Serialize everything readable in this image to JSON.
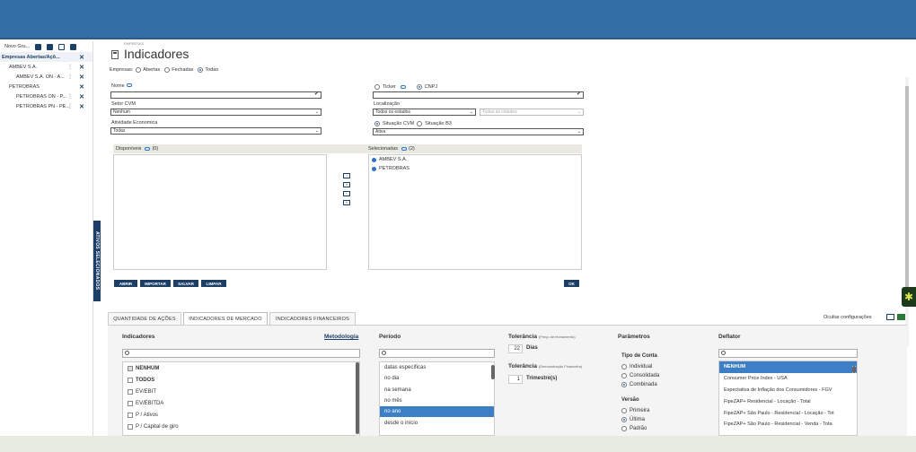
{
  "left_panel": {
    "toolbar_label": "Novo Gru...",
    "tree": [
      {
        "label": "Empresas Abertas/Açõ...",
        "header": true,
        "dots": false
      },
      {
        "label": "AMBEV S.A.",
        "indent": 1,
        "dots": true
      },
      {
        "label": "AMBEV S.A. ON - A...",
        "indent": 2,
        "dots": true
      },
      {
        "label": "PETROBRAS",
        "indent": 1,
        "dots": false
      },
      {
        "label": "PETROBRAS ON - P...",
        "indent": 2,
        "dots": true
      },
      {
        "label": "PETROBRAS PN - PE...",
        "indent": 2,
        "dots": true
      }
    ],
    "side_tab": "ATIVOS SELECIONADOS"
  },
  "header": {
    "breadcrumb": "EMPRESAS",
    "title": "Indicadores"
  },
  "empresas": {
    "label": "Empresas:",
    "options": [
      "Abertas",
      "Fechadas",
      "Todas"
    ],
    "selected": "Todas"
  },
  "filters": {
    "nome_label": "Nome",
    "ticker_label": "Ticker",
    "cnpj_label": "CNPJ",
    "setor_label": "Setor CVM",
    "setor_value": "Nenhum",
    "localizacao_label": "Localização",
    "localizacao_value": "Todos os estados",
    "cidades_value": "Todas as cidades",
    "atividade_label": "Atividade Economica",
    "atividade_value": "Todas",
    "situacao_cvm_label": "Situação CVM",
    "situacao_b3_label": "Situação B3",
    "situacao_value": "Ativa"
  },
  "lists": {
    "disponiveis_label": "Disponíveis",
    "disponiveis_count": "(0)",
    "selecionadas_label": "Selecionadas",
    "selecionadas_count": "(2)",
    "selecionadas_items": [
      "AMBEV S.A.",
      "PETROBRAS"
    ]
  },
  "buttons": {
    "abrir": "ABRIR",
    "importar": "IMPORTAR",
    "salvar": "SALVAR",
    "limpar": "LIMPAR",
    "ok": "OK"
  },
  "tabs": [
    "QUANTIDADE DE AÇÕES",
    "INDICADORES DE MERCADO",
    "INDICADORES FINANCEIROS"
  ],
  "active_tab": "INDICADORES DE MERCADO",
  "ocultar_label": "Ocultar configurações",
  "indicadores": {
    "title": "Indicadores",
    "metodologia": "Metodologia",
    "items": [
      {
        "label": "NENHUM",
        "bold": true,
        "checked": true
      },
      {
        "label": "TODOS",
        "bold": true,
        "checked": false
      },
      {
        "label": "EV/EBIT",
        "bold": false,
        "checked": false
      },
      {
        "label": "EV/EBITDA",
        "bold": false,
        "checked": false
      },
      {
        "label": "P / Ativos",
        "bold": false,
        "checked": false
      },
      {
        "label": "P / Capital de giro",
        "bold": false,
        "checked": false
      }
    ]
  },
  "periodo": {
    "title": "Período",
    "items": [
      "datas específicas",
      "no dia",
      "na semana",
      "no mês",
      "no ano",
      "desde o início"
    ],
    "selected": "no ano"
  },
  "tolerancia": {
    "title1": "Tolerância",
    "note1": "(Preço de fechamento)",
    "value1": "22",
    "unit1": "Dias",
    "title2": "Tolerância",
    "note2": "(Demonstração Financeira)",
    "value2": "1",
    "unit2": "Trimestre(s)"
  },
  "parametros": {
    "title": "Parâmetros",
    "tipo_label": "Tipo de Conta",
    "tipo_options": [
      "Individual",
      "Consolidada",
      "Combinada"
    ],
    "tipo_selected": "Combinada",
    "versao_label": "Versão",
    "versao_options": [
      "Primeira",
      "Última",
      "Padrão"
    ],
    "versao_selected": "Última"
  },
  "deflator": {
    "title": "Deflator",
    "items": [
      "NENHUM",
      "Consumer Price Index - USA",
      "Expectativa de Inflação dos Consumidores - FGV",
      "FipeZAP+ Residencial - Locação - Total",
      "FipeZAP+ São Paulo - Residencial - Locação - Tot",
      "FipeZAP+ São Paulo - Residencial - Venda - Tota"
    ],
    "selected": "NENHUM"
  },
  "colors": {
    "topbar": "#336ea4",
    "navy": "#1d3f66",
    "highlight": "#3c7fc4"
  }
}
